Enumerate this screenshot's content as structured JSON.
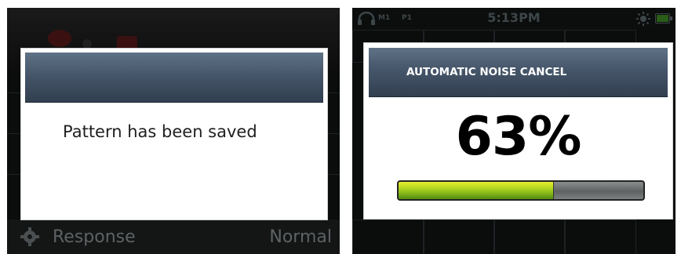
{
  "left_screen": {
    "dialog": {
      "message": "Pattern has been saved"
    },
    "background_row": {
      "label": "Response",
      "value": "Normal",
      "icon": "gear-icon"
    }
  },
  "right_screen": {
    "status_bar": {
      "time": "5:13PM",
      "m1": "M1",
      "p1": "P1",
      "icons": [
        "headphones-icon",
        "brightness-icon",
        "battery-icon"
      ]
    },
    "dialog": {
      "title": "AUTOMATIC NOISE CANCEL",
      "value_text": "63%",
      "level": 0.63,
      "bar_colors": {
        "fill_top": "#e8ef2c",
        "fill_bottom": "#4f8d12",
        "track": "#6e7272"
      }
    }
  }
}
